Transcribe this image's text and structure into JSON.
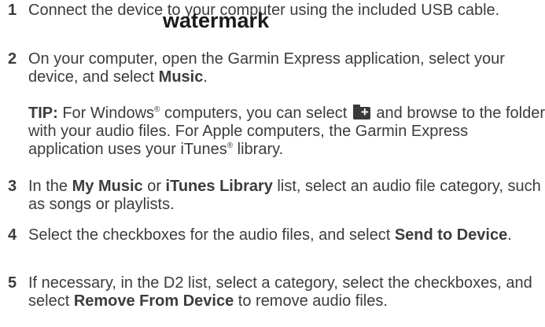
{
  "steps": [
    {
      "number": "1",
      "text": "Connect the device to your computer using the included USB cable."
    },
    {
      "number": "2",
      "text_a": "On your computer, open the Garmin Express application, select your device, and select ",
      "bold_a": "Music",
      "text_b": ".",
      "tip": {
        "label": "TIP:",
        "text_a": " For Windows",
        "reg1": "®",
        "text_b": " computers, you can select ",
        "icon": "add-folder-icon",
        "text_c": " and browse to the folder with your audio files. For Apple computers, the Garmin Express application uses your iTunes",
        "reg2": "®",
        "text_d": " library."
      }
    },
    {
      "number": "3",
      "text_a": "In the ",
      "bold_a": "My Music",
      "text_b": " or ",
      "bold_b": "iTunes Library",
      "text_c": " list, select an audio file category, such as songs or playlists."
    },
    {
      "number": "4",
      "text_a": "Select the checkboxes for the audio files, and select ",
      "bold_a": "Send to Device",
      "text_b": "."
    },
    {
      "number": "5",
      "text_a": "If necessary, in the D2 list, select a category, select the checkboxes, and select ",
      "bold_a": "Remove From Device",
      "text_b": " to remove audio files."
    }
  ],
  "watermark": "watermark"
}
